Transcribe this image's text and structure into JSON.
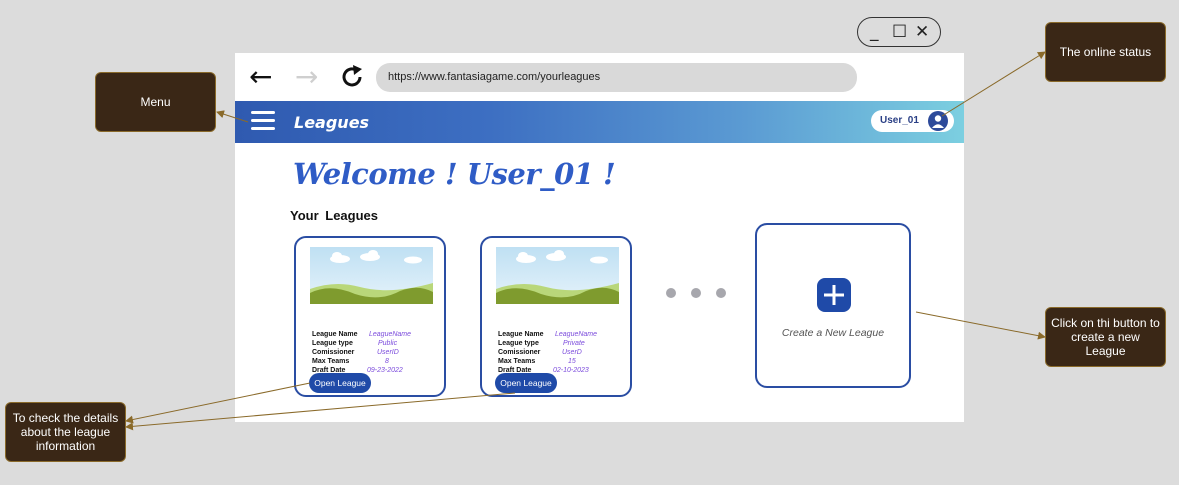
{
  "browser": {
    "url": "https://www.fantasiagame.com/yourleagues",
    "window_controls": [
      "_",
      "☐",
      "✕"
    ]
  },
  "header": {
    "title": "Leagues",
    "user": "User_01"
  },
  "main": {
    "welcome": "Welcome ! User_01 !",
    "section_title": "Your  Leagues",
    "leagues": [
      {
        "fields": [
          {
            "label": "League Name",
            "value": "LeagueName"
          },
          {
            "label": "League type",
            "value": "Public"
          },
          {
            "label": "Comissioner",
            "value": "UserID"
          },
          {
            "label": "Max Teams",
            "value": "8"
          },
          {
            "label": "Draft Date",
            "value": "09-23-2022"
          }
        ],
        "button": "Open League"
      },
      {
        "fields": [
          {
            "label": "League Name",
            "value": "LeagueName"
          },
          {
            "label": "League type",
            "value": "Private"
          },
          {
            "label": "Comissioner",
            "value": "UserD"
          },
          {
            "label": "Max Teams",
            "value": "15"
          },
          {
            "label": "Draft Date",
            "value": "02-10-2023"
          }
        ],
        "button": "Open League"
      }
    ],
    "new_league_label": "Create a New League"
  },
  "annotations": {
    "menu": "Menu",
    "online_status": "The online status",
    "create_league": "Click on thi button to create a new League",
    "league_details": "To check the details about the league information"
  },
  "colors": {
    "accent": "#1f4aa8",
    "annotation_bg": "#3a2716",
    "arrow": "#8a6a2a"
  }
}
